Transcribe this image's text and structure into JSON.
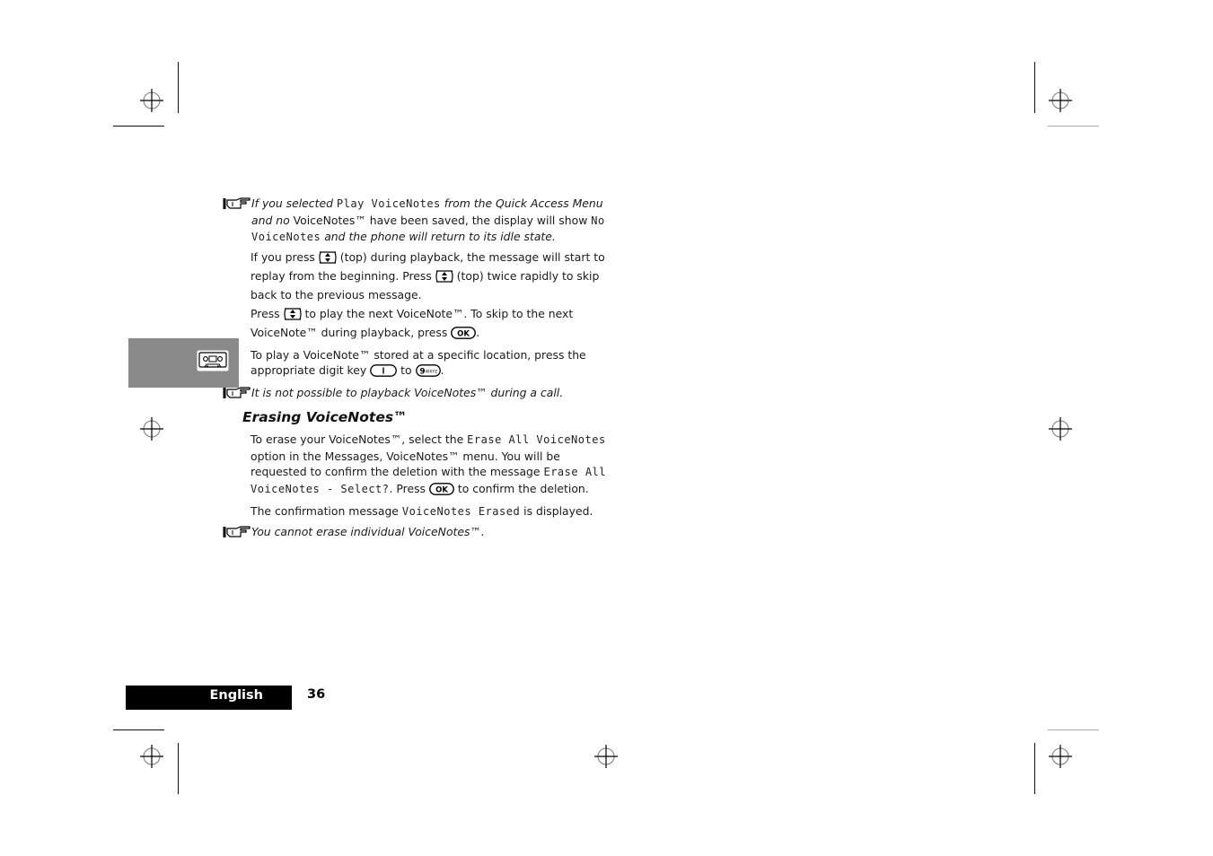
{
  "page": {
    "language_tab": "English",
    "page_number": "36",
    "section_icon": "cassette-tape-icon"
  },
  "notes": {
    "note1": {
      "p1": "If you selected ",
      "lcd1": "Play VoiceNotes",
      "p2": " from the Quick Access Menu and no ",
      "p3": "VoiceNotes™ have been saved, the display will show ",
      "lcd2": "No VoiceNotes",
      "p4": " and the phone will return to its idle state."
    },
    "note2": "It is not possible to playback VoiceNotes™ during a call.",
    "note3": "You cannot erase individual VoiceNotes™."
  },
  "paragraphs": {
    "replay": {
      "a": "If you press ",
      "b": " (top) during playback, the message will start to replay from the beginning. Press ",
      "c": " (top) twice rapidly to skip back to the previous message."
    },
    "next": {
      "a": "Press ",
      "b": " to play the next VoiceNote™. To skip to the next VoiceNote™ during playback, press ",
      "c": "."
    },
    "digit": {
      "a": "To play a VoiceNote™ stored at a specific location, press the appropriate digit key ",
      "b": " to ",
      "c": "."
    }
  },
  "erasing": {
    "heading": "Erasing VoiceNotes™",
    "p1": {
      "a": "To erase your VoiceNotes™, select the ",
      "lcd1": "Erase All VoiceNotes",
      "b": " option in the Messages, VoiceNotes™ menu. You will be requested to confirm the deletion with the message ",
      "lcd2": "Erase All VoiceNotes - Select?",
      "c": ". Press ",
      "d": " to confirm the deletion."
    },
    "p2": {
      "a": "The confirmation message ",
      "lcd": "VoiceNotes Erased",
      "b": " is displayed."
    }
  },
  "keys": {
    "ok": "OK",
    "one": "1",
    "nine": "9",
    "nine_letters": "WXYZ"
  }
}
